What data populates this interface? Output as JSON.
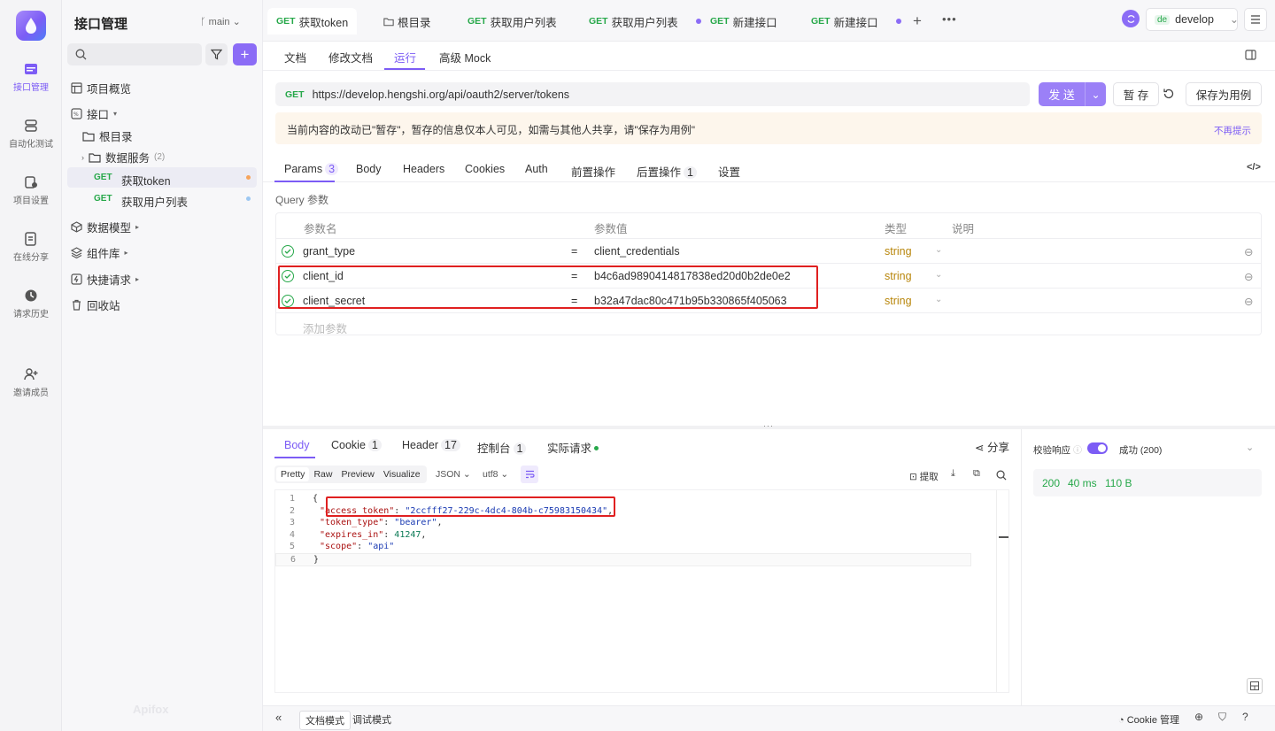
{
  "rail": {
    "items": [
      {
        "label": "接口管理"
      },
      {
        "label": "自动化测试"
      },
      {
        "label": "项目设置"
      },
      {
        "label": "在线分享"
      },
      {
        "label": "请求历史"
      },
      {
        "label": "邀请成员"
      }
    ]
  },
  "sidebar": {
    "title": "接口管理",
    "branch": "main",
    "tree": {
      "overview": "项目概览",
      "api": "接口",
      "root": "根目录",
      "data_service": "数据服务",
      "data_service_count": "(2)",
      "req1_method": "GET",
      "req1_name": "获取token",
      "req2_method": "GET",
      "req2_name": "获取用户列表",
      "model": "数据模型",
      "components": "组件库",
      "quick": "快捷请求",
      "trash": "回收站"
    },
    "watermark": "Apifox"
  },
  "tabs": [
    {
      "method": "GET",
      "label": "获取token"
    },
    {
      "method": "",
      "label": "根目录"
    },
    {
      "method": "GET",
      "label": "获取用户列表"
    },
    {
      "method": "GET",
      "label": "获取用户列表"
    },
    {
      "method": "GET",
      "label": "新建接口"
    },
    {
      "method": "GET",
      "label": "新建接口"
    }
  ],
  "env": {
    "prefix": "de",
    "name": "develop"
  },
  "subtabs": [
    "文档",
    "修改文档",
    "运行",
    "高级 Mock"
  ],
  "request": {
    "method": "GET",
    "url": "https://develop.hengshi.org/api/oauth2/server/tokens",
    "send": "发 送",
    "save_draft": "暂 存",
    "save_case": "保存为用例"
  },
  "notice": {
    "text": "当前内容的改动已\"暂存\"，暂存的信息仅本人可见，如需与其他人共享，请\"保存为用例\"",
    "dismiss": "不再提示"
  },
  "param_tabs": [
    {
      "label": "Params",
      "badge": "3"
    },
    {
      "label": "Body",
      "badge": ""
    },
    {
      "label": "Headers",
      "badge": ""
    },
    {
      "label": "Cookies",
      "badge": ""
    },
    {
      "label": "Auth",
      "badge": ""
    },
    {
      "label": "前置操作",
      "badge": ""
    },
    {
      "label": "后置操作",
      "badge": "1"
    },
    {
      "label": "设置",
      "badge": ""
    }
  ],
  "query_label": "Query 参数",
  "params_table": {
    "headers": {
      "name": "参数名",
      "value": "参数值",
      "type": "类型",
      "desc": "说明"
    },
    "rows": [
      {
        "name": "grant_type",
        "eq": "=",
        "value": "client_credentials",
        "type": "string"
      },
      {
        "name": "client_id",
        "eq": "=",
        "value": "b4c6ad9890414817838ed20d0b2de0e2",
        "type": "string"
      },
      {
        "name": "client_secret",
        "eq": "=",
        "value": "b32a47dac80c471b95b330865f405063",
        "type": "string"
      }
    ],
    "add_placeholder": "添加参数"
  },
  "response": {
    "tabs": [
      {
        "label": "Body",
        "badge": ""
      },
      {
        "label": "Cookie",
        "badge": "1"
      },
      {
        "label": "Header",
        "badge": "17"
      },
      {
        "label": "控制台",
        "badge": "1"
      },
      {
        "label": "实际请求",
        "badge": ""
      }
    ],
    "share": "分享",
    "view_modes": [
      "Pretty",
      "Raw",
      "Preview",
      "Visualize"
    ],
    "format": "JSON",
    "encoding": "utf8",
    "extract": "提取",
    "code_lines": {
      "l1": "{",
      "access_token_key": "\"access_token\"",
      "access_token_val": "\"2ccfff27-229c-4dc4-804b-c75983150434\"",
      "token_type_key": "\"token_type\"",
      "token_type_val": "\"bearer\"",
      "expires_in_key": "\"expires_in\"",
      "expires_in_val": "41247",
      "scope_key": "\"scope\"",
      "scope_val": "\"api\"",
      "l6": "}"
    },
    "validate_label": "校验响应",
    "validate_status": "成功 (200)",
    "status_code": "200",
    "time": "40 ms",
    "size": "110 B"
  },
  "bottom": {
    "doc_mode": "文档模式",
    "debug_mode": "调试模式",
    "cookie_mgr": "Cookie 管理"
  },
  "colors": {
    "accent": "#8b6cf6",
    "get": "#27a84a",
    "highlight": "#e02020"
  }
}
